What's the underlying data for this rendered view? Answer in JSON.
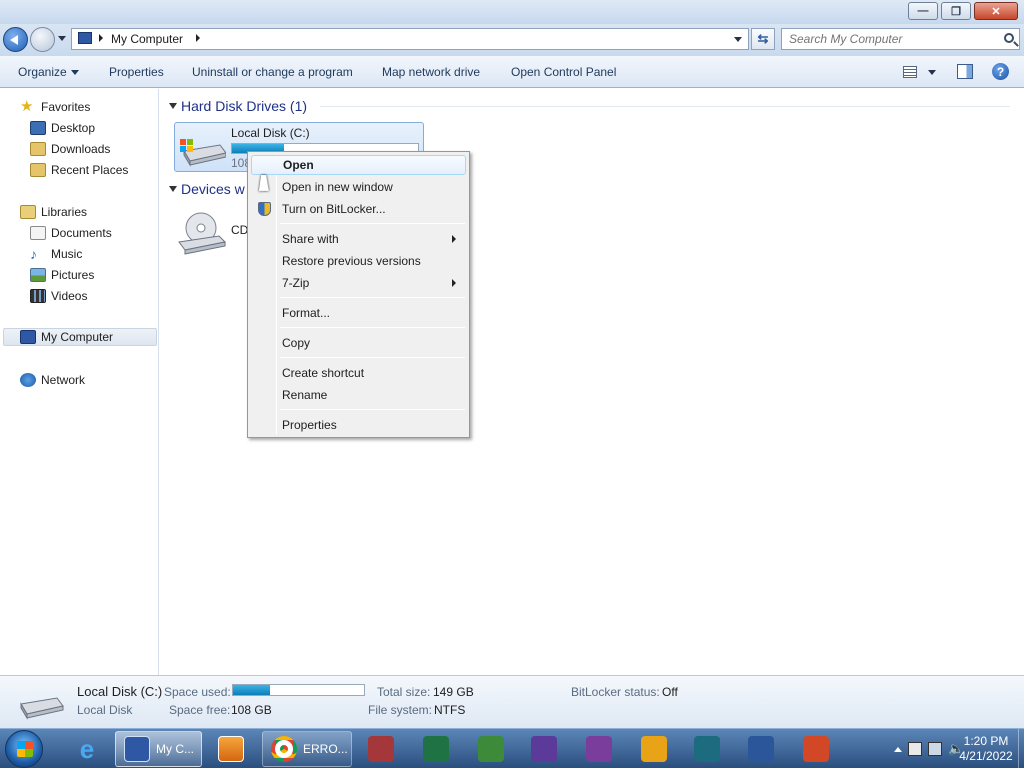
{
  "window": {
    "controls": {
      "minimize": "—",
      "maximize": "❐",
      "close": "✕"
    }
  },
  "address": {
    "path": "My Computer",
    "search_placeholder": "Search My Computer"
  },
  "toolbar": {
    "organize": "Organize",
    "properties": "Properties",
    "uninstall": "Uninstall or change a program",
    "map_drive": "Map network drive",
    "control_panel": "Open Control Panel",
    "help": "?"
  },
  "nav": {
    "favorites": "Favorites",
    "desktop": "Desktop",
    "downloads": "Downloads",
    "recent": "Recent Places",
    "libraries": "Libraries",
    "documents": "Documents",
    "music": "Music",
    "pictures": "Pictures",
    "videos": "Videos",
    "computer": "My Computer",
    "network": "Network"
  },
  "content": {
    "hdd_group": "Hard Disk Drives (1)",
    "devices_group": "Devices w",
    "drive": {
      "name": "Local Disk (C:)",
      "free_text": "108",
      "used_fraction": 0.28
    },
    "cd_label": "CD"
  },
  "context_menu": {
    "open": "Open",
    "open_new_window": "Open in new window",
    "bitlocker": "Turn on BitLocker...",
    "share_with": "Share with",
    "restore": "Restore previous versions",
    "zip": "7-Zip",
    "format": "Format...",
    "copy": "Copy",
    "create_shortcut": "Create shortcut",
    "rename": "Rename",
    "properties": "Properties"
  },
  "details": {
    "title": "Local Disk (C:)",
    "subtitle": "Local Disk",
    "space_used_label": "Space used:",
    "space_free_label": "Space free:",
    "space_free_value": "108 GB",
    "total_size_label": "Total size:",
    "total_size_value": "149 GB",
    "filesystem_label": "File system:",
    "filesystem_value": "NTFS",
    "bitlocker_label": "BitLocker status:",
    "bitlocker_value": "Off",
    "used_fraction": 0.28
  },
  "taskbar": {
    "explorer_label": "My C...",
    "chrome_label": "ERRO...",
    "time": "1:20 PM",
    "date": "4/21/2022"
  }
}
